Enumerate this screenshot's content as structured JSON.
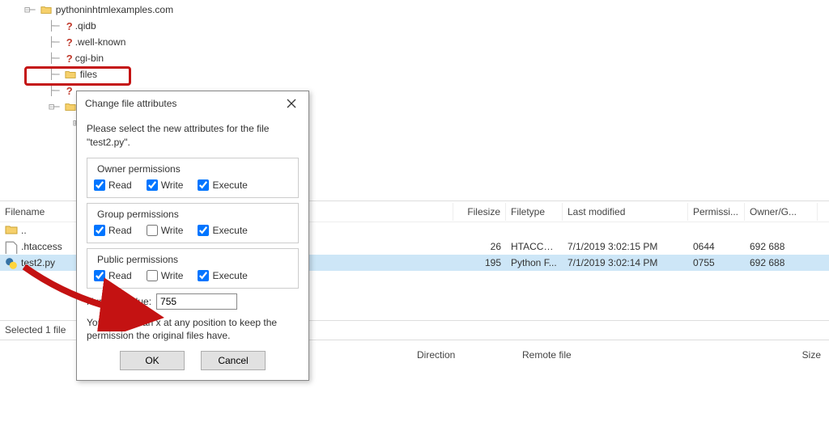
{
  "tree": {
    "root": "pythoninhtmlexamples.com",
    "items": [
      ".qidb",
      ".well-known",
      "cgi-bin",
      "files"
    ]
  },
  "fileList": {
    "columns": {
      "name": "Filename",
      "size": "Filesize",
      "type": "Filetype",
      "modified": "Last modified",
      "perm": "Permissi...",
      "owner": "Owner/G..."
    },
    "parent": "..",
    "rows": [
      {
        "name": ".htaccess",
        "size": "26",
        "type": "HTACCE...",
        "modified": "7/1/2019 3:02:15 PM",
        "perm": "0644",
        "owner": "692 688"
      },
      {
        "name": "test2.py",
        "size": "195",
        "type": "Python F...",
        "modified": "7/1/2019 3:02:14 PM",
        "perm": "0755",
        "owner": "692 688"
      }
    ],
    "status": "Selected 1 file"
  },
  "bottom": {
    "direction": "Direction",
    "remote": "Remote file",
    "size": "Size"
  },
  "dialog": {
    "title": "Change file attributes",
    "instruction": "Please select the new attributes for the file \"test2.py\".",
    "groups": {
      "owner": "Owner permissions",
      "group": "Group permissions",
      "public": "Public permissions"
    },
    "perm": {
      "read": "Read",
      "write": "Write",
      "execute": "Execute"
    },
    "values": {
      "owner": {
        "read": true,
        "write": true,
        "execute": true
      },
      "group": {
        "read": true,
        "write": false,
        "execute": true
      },
      "public": {
        "read": true,
        "write": false,
        "execute": true
      }
    },
    "numericLabel": "Numeric value:",
    "numeric": "755",
    "hint": "You can use an x at any position to keep the permission the original files have.",
    "ok": "OK",
    "cancel": "Cancel"
  }
}
